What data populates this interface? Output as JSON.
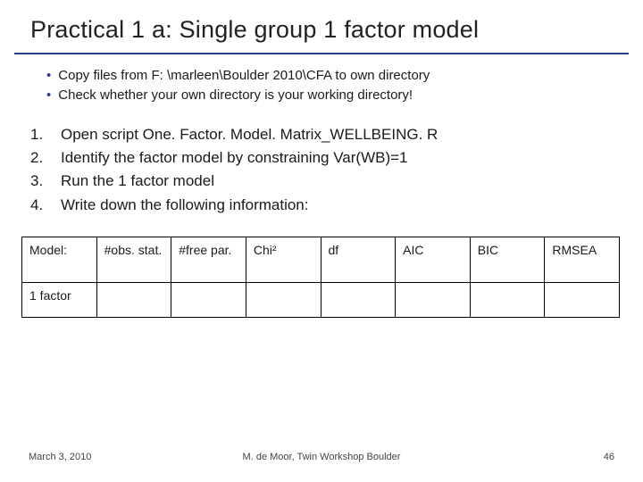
{
  "title": "Practical 1 a: Single group 1 factor model",
  "bullets": [
    "Copy files from  F: \\marleen\\Boulder 2010\\CFA to own directory",
    "Check whether your own directory is your working directory!"
  ],
  "steps": [
    {
      "n": "1.",
      "t": "Open script One. Factor. Model. Matrix_WELLBEING. R"
    },
    {
      "n": "2.",
      "t": "Identify the factor model by constraining Var(WB)=1"
    },
    {
      "n": "3.",
      "t": "Run the 1 factor model"
    },
    {
      "n": "4.",
      "t": "Write down the following information:"
    }
  ],
  "chart_data": {
    "type": "table",
    "headers": [
      "Model:",
      "#obs. stat.",
      "#free par.",
      "Chi²",
      "df",
      "AIC",
      "BIC",
      "RMSEA"
    ],
    "rows": [
      {
        "label": "1 factor",
        "cells": [
          "",
          "",
          "",
          "",
          "",
          "",
          ""
        ]
      }
    ]
  },
  "footer": {
    "left": "March 3, 2010",
    "center": "M. de Moor, Twin Workshop Boulder",
    "right": "46"
  }
}
